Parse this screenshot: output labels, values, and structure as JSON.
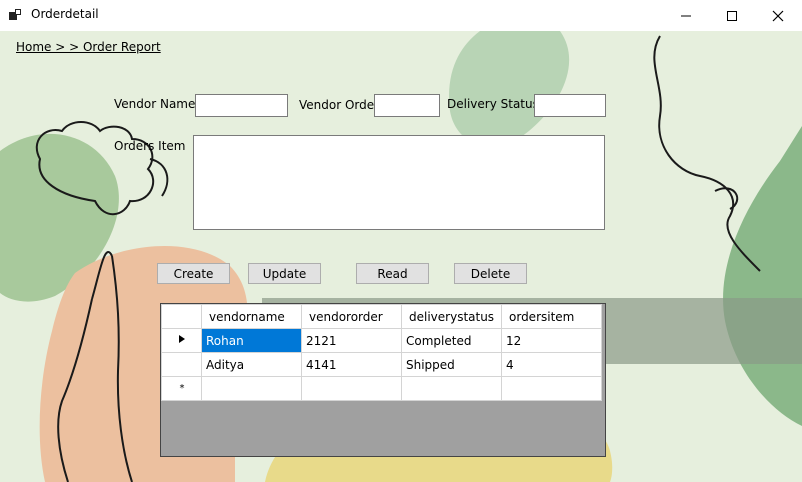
{
  "window": {
    "title": "Orderdetail"
  },
  "breadcrumb": "Home > > Order Report",
  "form": {
    "vendor_name_label": "Vendor Name",
    "vendor_order_label": "Vendor Order",
    "delivery_status_label": "Delivery Status",
    "orders_item_label": "Orders Item",
    "vendor_name_value": "",
    "vendor_order_value": "",
    "delivery_status_value": "",
    "orders_item_value": ""
  },
  "buttons": {
    "create": "Create",
    "update": "Update",
    "read": "Read",
    "delete": "Delete"
  },
  "grid": {
    "columns": [
      "vendorname",
      "vendororder",
      "deliverystatus",
      "ordersitem"
    ],
    "rows": [
      [
        "Rohan",
        "2121",
        "Completed",
        "12"
      ],
      [
        "Aditya",
        "4141",
        "Shipped",
        "4"
      ]
    ],
    "selected_row": 0
  },
  "colors": {
    "background": "#e6efdd",
    "selection": "#0078d7",
    "grid_empty": "#a0a0a0"
  }
}
